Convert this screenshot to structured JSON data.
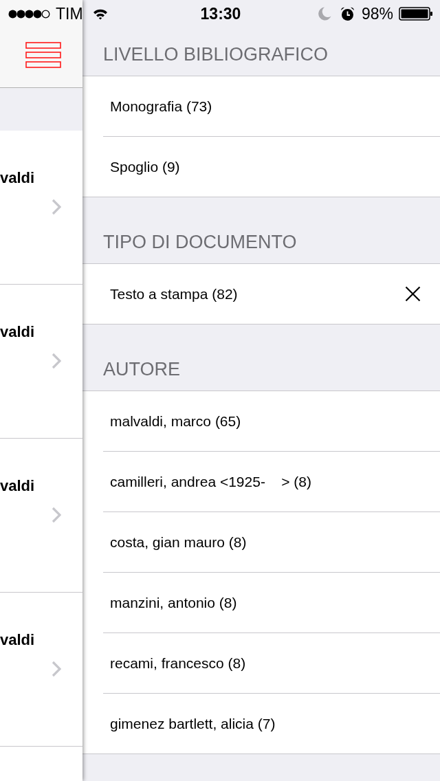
{
  "status_bar": {
    "carrier": "TIM",
    "time": "13:30",
    "battery": "98%"
  },
  "results_list": {
    "rows": [
      {
        "title": "valdi"
      },
      {
        "title": "valdi"
      },
      {
        "title": "valdi"
      },
      {
        "title": "valdi"
      }
    ]
  },
  "filters": {
    "sections": [
      {
        "title": "LIVELLO BIBLIOGRAFICO",
        "items": [
          {
            "label": "Monografia (73)",
            "selected": false
          },
          {
            "label": "Spoglio (9)",
            "selected": false
          }
        ]
      },
      {
        "title": "TIPO DI DOCUMENTO",
        "items": [
          {
            "label": "Testo a stampa (82)",
            "selected": true
          }
        ]
      },
      {
        "title": "AUTORE",
        "items": [
          {
            "label": "malvaldi, marco (65)",
            "selected": false
          },
          {
            "label": "camilleri, andrea <1925-    > (8)",
            "selected": false
          },
          {
            "label": "costa, gian mauro (8)",
            "selected": false
          },
          {
            "label": "manzini, antonio (8)",
            "selected": false
          },
          {
            "label": "recami, francesco (8)",
            "selected": false
          },
          {
            "label": "gimenez bartlett, alicia (7)",
            "selected": false
          }
        ]
      }
    ]
  }
}
